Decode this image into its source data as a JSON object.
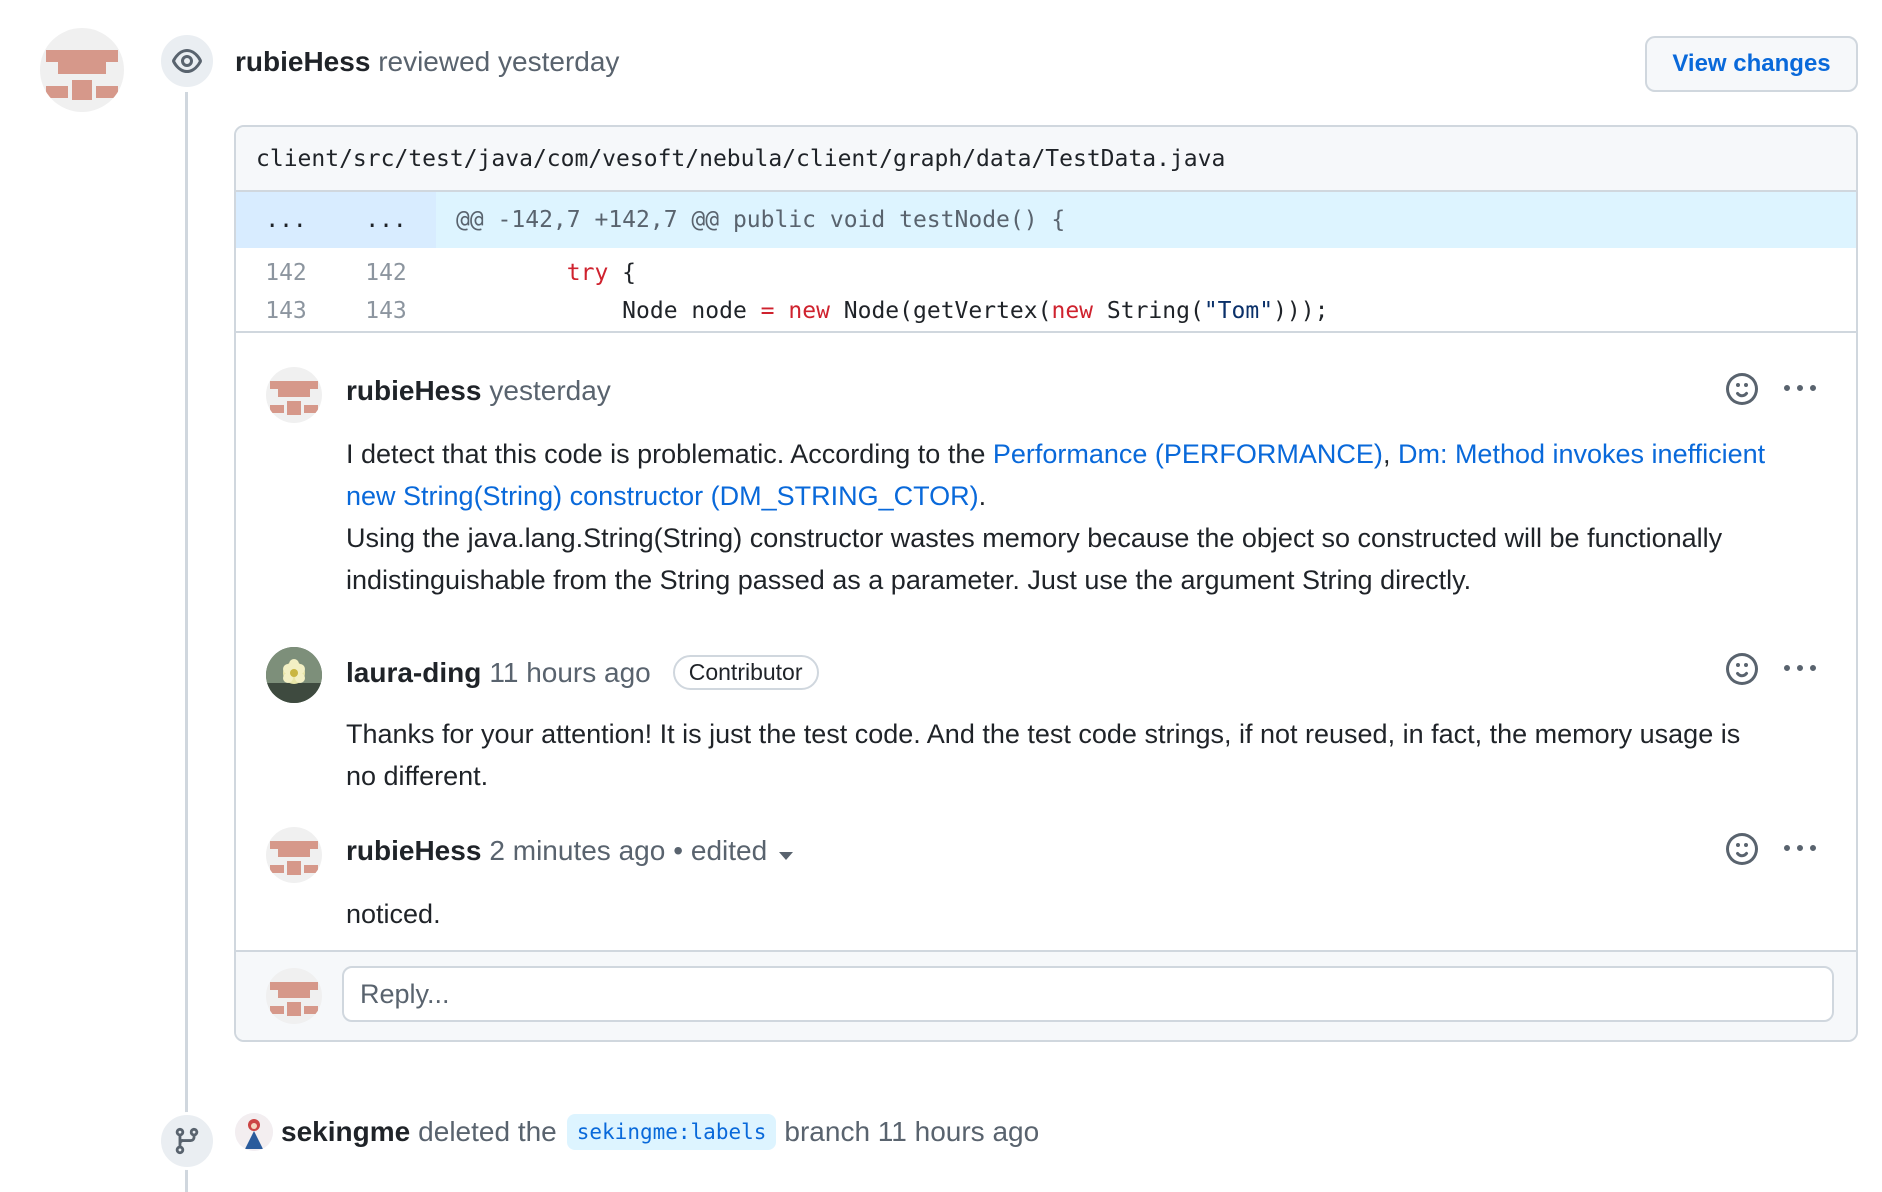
{
  "review": {
    "author": "rubieHess",
    "action": "reviewed",
    "time": "yesterday",
    "view_changes_label": "View changes"
  },
  "file": {
    "path": "client/src/test/java/com/vesoft/nebula/client/graph/data/TestData.java",
    "hunk_left": "...",
    "hunk_right": "...",
    "hunk_header": "@@ -142,7 +142,7 @@ public void testNode() {",
    "lines": [
      {
        "old": "142",
        "new": "142"
      },
      {
        "old": "143",
        "new": "143"
      }
    ],
    "code_line1": {
      "indent": "        ",
      "kw": "try",
      "rest": " {"
    },
    "code_line2": {
      "indent": "            ",
      "p1": "Node node ",
      "op": "=",
      "p2": " ",
      "kw1": "new",
      "p3": " Node(getVertex(",
      "kw2": "new",
      "p4": " String(",
      "str": "\"Tom\"",
      "p5": ")));"
    }
  },
  "comments": [
    {
      "author": "rubieHess",
      "time": "yesterday",
      "text_before": "I detect that this code is problematic. According to the ",
      "link1": "Performance (PERFORMANCE)",
      "sep": ", ",
      "link2": "Dm: Method invokes inefficient new String(String) constructor (DM_STRING_CTOR)",
      "text_after": ".",
      "text2": "Using the java.lang.String(String) constructor wastes memory because the object so constructed will be functionally indistinguishable from the String passed as a parameter.  Just use the argument String directly."
    },
    {
      "author": "laura-ding",
      "time": "11 hours ago",
      "badge": "Contributor",
      "text": "Thanks for your attention! It is just the test code. And the test code strings, if not reused, in fact, the memory usage is no different."
    },
    {
      "author": "rubieHess",
      "time": "2 minutes ago",
      "edited": "• edited",
      "text": "noticed."
    }
  ],
  "reply": {
    "placeholder": "Reply..."
  },
  "event": {
    "author": "sekingme",
    "action": "deleted the",
    "branch": "sekingme:labels",
    "suffix": "branch 11 hours ago"
  },
  "icons": {
    "review": "eye-icon",
    "branch": "git-branch-icon",
    "reaction": "smiley-icon",
    "more": "kebab-horizontal-icon"
  },
  "colors": {
    "link": "#0969da",
    "keyword": "#cf222e",
    "string": "#0a3069",
    "hunk_bg": "#ddf4ff",
    "identicon": "#d6988a"
  }
}
